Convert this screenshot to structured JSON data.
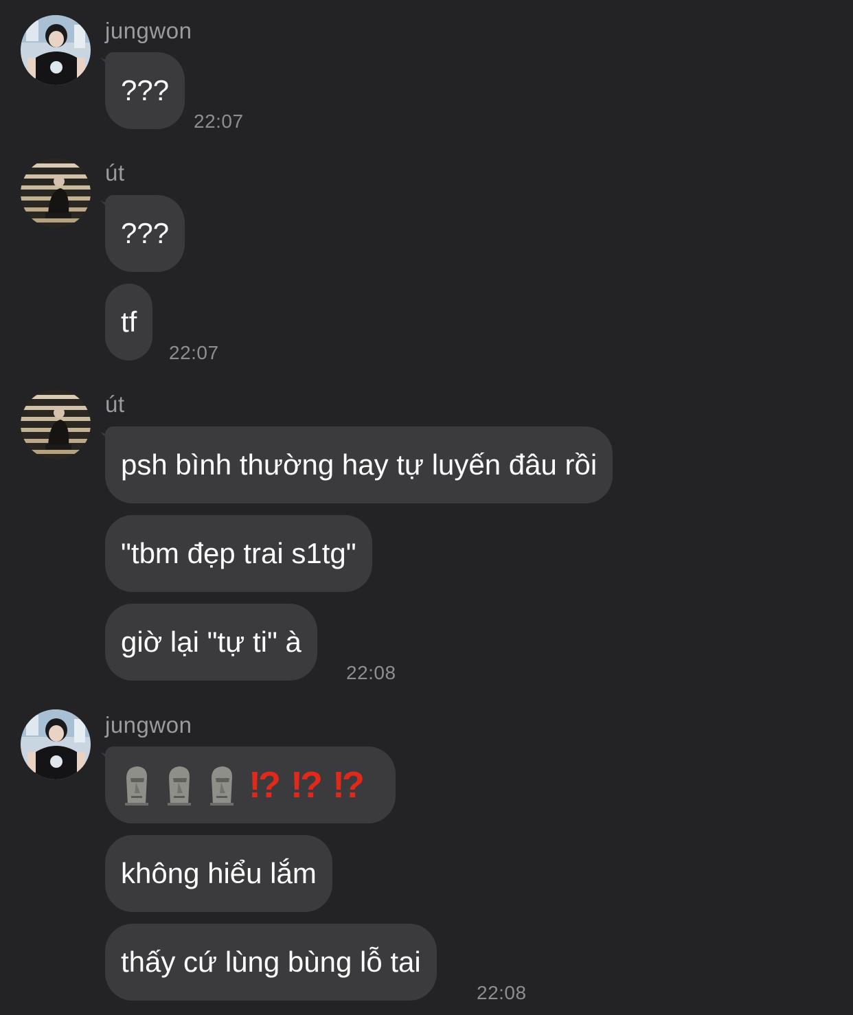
{
  "colors": {
    "background": "#232325",
    "bubble": "#3b3b3e",
    "text": "#ffffff",
    "name": "#9b9b9f",
    "time": "#8e8e92",
    "interrobang": "#e0281b"
  },
  "groups": [
    {
      "sender": "jungwon",
      "avatar_icon": "user-avatar-jungwon",
      "messages": [
        "???"
      ],
      "time": "22:07"
    },
    {
      "sender": "út",
      "avatar_icon": "user-avatar-ut",
      "messages": [
        "???",
        "tf"
      ],
      "time": "22:07"
    },
    {
      "sender": "út",
      "avatar_icon": "user-avatar-ut",
      "messages": [
        "psh bình thường hay tự luyến đâu rồi",
        "\"tbm đẹp trai s1tg\"",
        "giờ lại \"tự ti\" à"
      ],
      "time": "22:08"
    },
    {
      "sender": "jungwon",
      "avatar_icon": "user-avatar-jungwon",
      "messages": [
        "🗿🗿🗿⁉️⁉️⁉️",
        "không hiểu lắm",
        "thấy cứ lùng bùng lỗ tai"
      ],
      "time": "22:08"
    }
  ]
}
